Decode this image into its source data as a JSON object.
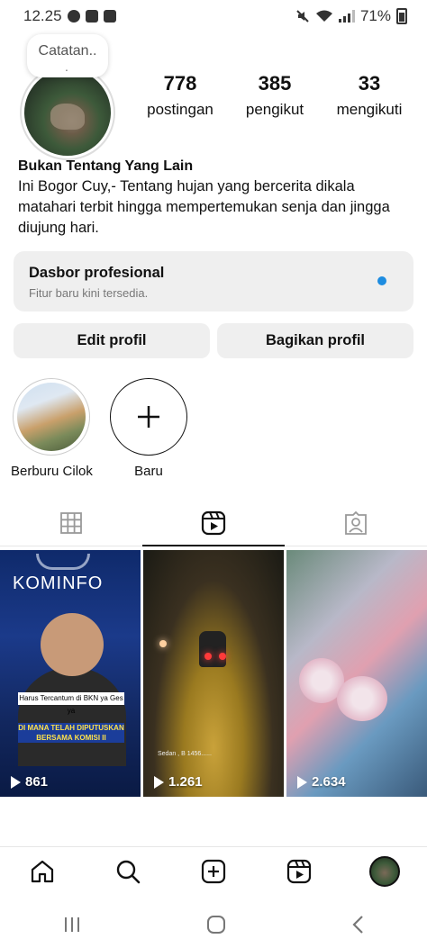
{
  "status_bar": {
    "time": "12.25",
    "battery": "71%"
  },
  "profile": {
    "note": "Catatan..",
    "stats": [
      {
        "num": "778",
        "label": "postingan"
      },
      {
        "num": "385",
        "label": "pengikut"
      },
      {
        "num": "33",
        "label": "mengikuti"
      }
    ],
    "name": "Bukan Tentang Yang Lain",
    "bio": "Ini Bogor Cuy,- Tentang hujan yang bercerita dikala matahari terbit hingga mempertemukan senja dan jingga diujung hari."
  },
  "dashboard": {
    "title": "Dasbor profesional",
    "subtitle": "Fitur baru kini tersedia.",
    "dot_color": "#1d8ce0"
  },
  "buttons": {
    "edit": "Edit profil",
    "share": "Bagikan profil"
  },
  "highlights": [
    {
      "label": "Berburu Cilok"
    },
    {
      "label": "Baru",
      "icon": "plus-icon"
    }
  ],
  "tabs": [
    {
      "icon": "grid-icon",
      "active": false
    },
    {
      "icon": "reels-icon",
      "active": true
    },
    {
      "icon": "tagged-icon",
      "active": false
    }
  ],
  "posts": [
    {
      "views": "861",
      "brand": "KOMINFO",
      "caption_1": "Harus Tercantum di BKN ya Ges ya",
      "caption_2": "DI MANA TELAH DIPUTUSKAN BERSAMA KOMISI II"
    },
    {
      "views": "1.261",
      "note": "Sedan , B 1456......"
    },
    {
      "views": "2.634"
    }
  ],
  "bottom_nav": [
    "home-icon",
    "search-icon",
    "create-icon",
    "reels-icon",
    "profile-avatar"
  ],
  "colors": {
    "accent": "#1d8ce0",
    "button_bg": "#efefef"
  }
}
